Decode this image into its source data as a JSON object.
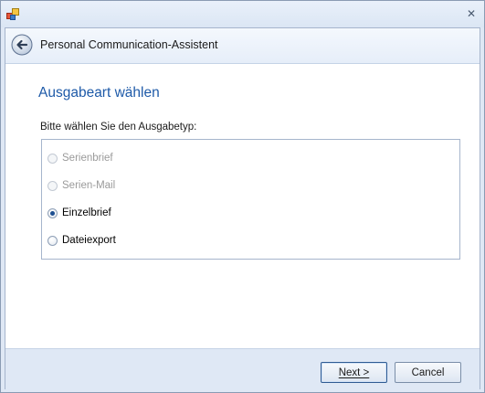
{
  "window": {
    "app_icon": "app-icon",
    "close_icon": "close-icon",
    "close_glyph": "✕"
  },
  "header": {
    "back_icon": "back-arrow-icon",
    "title": "Personal Communication-Assistent"
  },
  "page": {
    "heading": "Ausgabeart wählen",
    "prompt": "Bitte wählen Sie den Ausgabetyp:"
  },
  "options": [
    {
      "label": "Serienbrief",
      "enabled": false,
      "checked": false
    },
    {
      "label": "Serien-Mail",
      "enabled": false,
      "checked": false
    },
    {
      "label": "Einzelbrief",
      "enabled": true,
      "checked": true
    },
    {
      "label": "Dateiexport",
      "enabled": true,
      "checked": false
    }
  ],
  "footer": {
    "next_label": "Next >",
    "cancel_label": "Cancel"
  },
  "colors": {
    "heading_blue": "#1e5aa8",
    "frame": "#dfe8f5"
  }
}
